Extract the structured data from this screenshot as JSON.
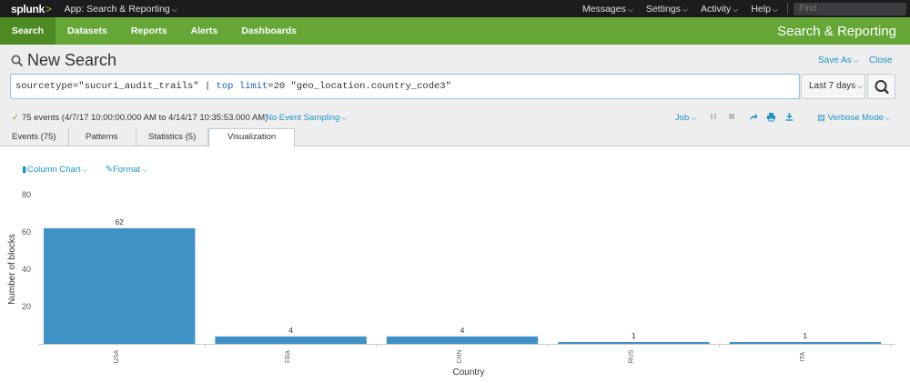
{
  "topbar": {
    "logo": "splunk",
    "logo_suffix": ">",
    "app": "App: Search & Reporting",
    "menus": [
      "Messages",
      "Settings",
      "Activity",
      "Help"
    ],
    "find_placeholder": "Find"
  },
  "nav": {
    "items": [
      "Search",
      "Datasets",
      "Reports",
      "Alerts",
      "Dashboards"
    ],
    "active": "Search",
    "app_title": "Search & Reporting"
  },
  "header": {
    "title": "New Search",
    "save_as": "Save As",
    "close": "Close"
  },
  "search": {
    "query_parts": [
      "sourcetype=\"sucuri_audit_trails\" | ",
      "top",
      " ",
      "limit",
      "=20 \"geo_location.country_code3\""
    ],
    "time_range": "Last 7 days"
  },
  "status": {
    "check": "✓",
    "events": "75 events (4/7/17 10:00:00.000 AM to 4/14/17 10:35:53.000 AM)",
    "sampling": "No Event Sampling",
    "job": "Job",
    "mode": "Verbose Mode"
  },
  "tabs": [
    "Events (75)",
    "Patterns",
    "Statistics (5)",
    "Visualization"
  ],
  "active_tab": "Visualization",
  "chart_tools": {
    "type_label": "Column Chart",
    "format_label": "Format"
  },
  "colors": {
    "bar": "#3f91c6",
    "nav_green": "#65a637",
    "link": "#1e93c6"
  },
  "chart_data": {
    "type": "bar",
    "categories": [
      "USA",
      "FRA",
      "CHN",
      "RUS",
      "ITA"
    ],
    "values": [
      62,
      4,
      4,
      1,
      1
    ],
    "xlabel": "Country",
    "ylabel": "Number of blocks",
    "ylim": [
      0,
      80
    ],
    "yticks": [
      20,
      40,
      60,
      80
    ],
    "data_labels": true,
    "grid": false
  }
}
